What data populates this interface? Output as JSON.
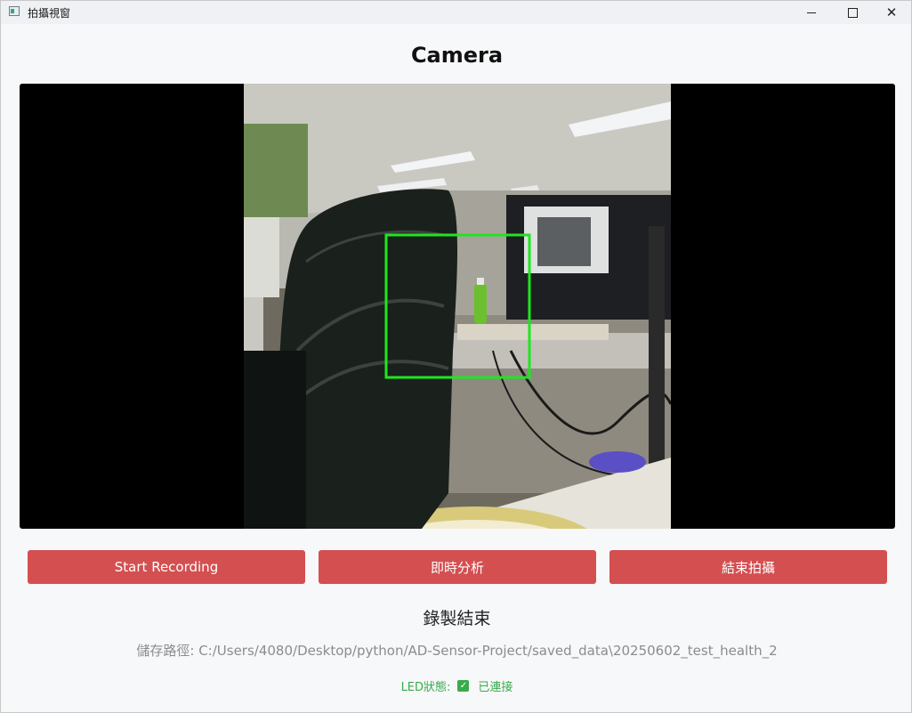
{
  "window": {
    "title": "拍攝視窗",
    "icon": "app-window-icon",
    "controls": {
      "minimize": "minimize-icon",
      "maximize": "maximize-icon",
      "close": "close-icon",
      "close_glyph": "✕"
    }
  },
  "heading": "Camera",
  "video": {
    "detection_box_color": "#1fe61f"
  },
  "buttons": {
    "start_recording": "Start Recording",
    "realtime_analysis": "即時分析",
    "end_capture": "結束拍攝",
    "color": "#d44f50"
  },
  "status": {
    "message": "錄製結束",
    "save_path": "儲存路徑: C:/Users/4080/Desktop/python/AD-Sensor-Project/saved_data\\20250602_test_health_2",
    "led_label": "LED狀態:",
    "led_icon": "checkbox-checked-icon",
    "led_value": "已連接",
    "led_color": "#3aaa4b"
  }
}
